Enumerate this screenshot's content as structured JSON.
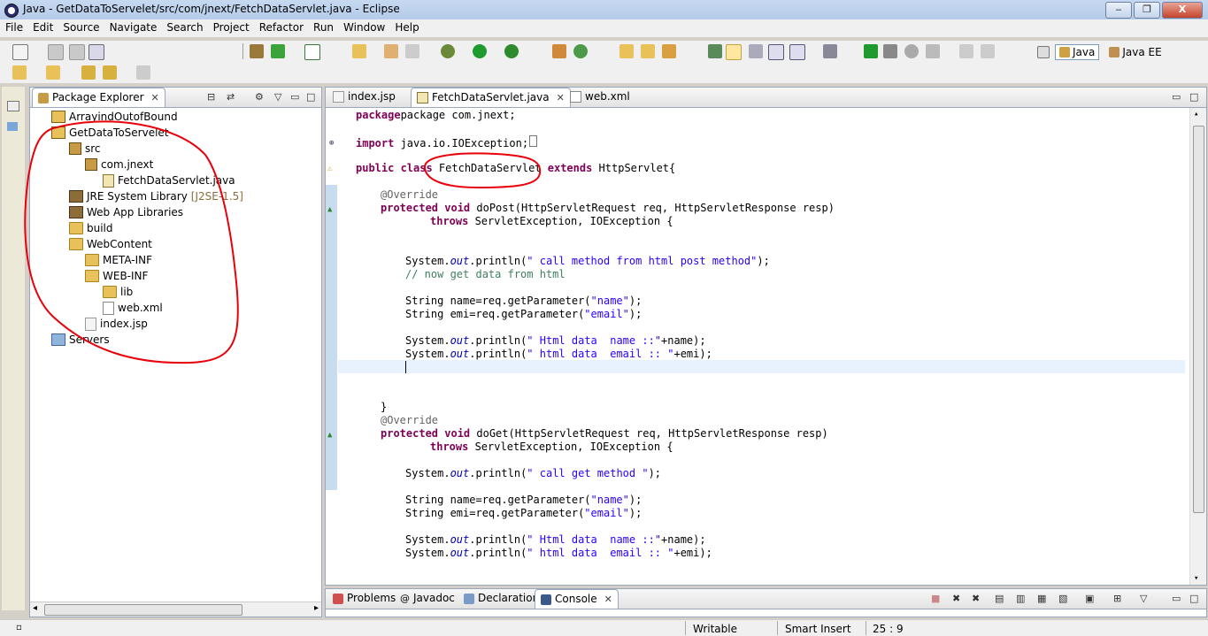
{
  "window": {
    "title": "Java - GetDataToServelet/src/com/jnext/FetchDataServlet.java - Eclipse",
    "minimize": "‒",
    "maximize": "❐",
    "close": "X"
  },
  "menu": [
    "File",
    "Edit",
    "Source",
    "Navigate",
    "Search",
    "Project",
    "Refactor",
    "Run",
    "Window",
    "Help"
  ],
  "perspectives": {
    "java": "Java",
    "javaee": "Java EE"
  },
  "package_explorer": {
    "title": "Package Explorer",
    "items": [
      {
        "label": "ArrayindOutofBound",
        "icon": "project-icon"
      },
      {
        "label": "GetDataToServelet",
        "icon": "project-icon"
      },
      {
        "label": "src",
        "icon": "source-folder-icon"
      },
      {
        "label": "com.jnext",
        "icon": "package-icon"
      },
      {
        "label": "FetchDataServlet.java",
        "icon": "java-file-icon"
      },
      {
        "label": "JRE System Library",
        "suffix": "[J2SE-1.5]",
        "icon": "library-icon"
      },
      {
        "label": "Web App Libraries",
        "icon": "library-icon"
      },
      {
        "label": "build",
        "icon": "folder-icon"
      },
      {
        "label": "WebContent",
        "icon": "folder-icon"
      },
      {
        "label": "META-INF",
        "icon": "folder-icon"
      },
      {
        "label": "WEB-INF",
        "icon": "folder-icon"
      },
      {
        "label": "lib",
        "icon": "folder-icon"
      },
      {
        "label": "web.xml",
        "icon": "xml-file-icon"
      },
      {
        "label": "index.jsp",
        "icon": "jsp-file-icon"
      },
      {
        "label": "Servers",
        "icon": "servers-folder-icon"
      }
    ]
  },
  "editor": {
    "tabs": [
      {
        "label": "index.jsp"
      },
      {
        "label": "FetchDataServlet.java"
      },
      {
        "label": "web.xml"
      }
    ],
    "lines": {
      "l1": "package com.jnext;",
      "l2_kw": "import",
      "l2": " java.io.IOException;",
      "l3_kw": "public class",
      "l3_name": " FetchDataServlet ",
      "l3_kw2": "extends",
      "l3_rest": " HttpServlet{",
      "l4": "@Override",
      "l5_kw": "protected void",
      "l5": " doPost(HttpServletRequest req, HttpServletResponse resp)",
      "l6_kw": "throws",
      "l6": " ServletException, IOException {",
      "l7_a": "System.",
      "l7_f": "out",
      "l7_b": ".println(",
      "l7_s": "\" call method from html post method\"",
      "l7_c": ");",
      "l8": "// now get data from html",
      "l9_a": "String name=req.getParameter(",
      "l9_s": "\"name\"",
      "l9_c": ");",
      "l10_a": "String emi=req.getParameter(",
      "l10_s": "\"email\"",
      "l10_c": ");",
      "l11_s": "\" Html data  name ::\"",
      "l11_c": "+name);",
      "l12_s": "\" html data  email :: \"",
      "l12_c": "+emi);",
      "l13": "}",
      "l14": "@Override",
      "l15": " doGet(HttpServletRequest req, HttpServletResponse resp)",
      "l16_s": "\" call get method \"",
      "l16_c": ");"
    }
  },
  "bottom_panel": {
    "tabs": [
      {
        "label": "Problems"
      },
      {
        "label": "Javadoc"
      },
      {
        "label": "Declaration"
      },
      {
        "label": "Console"
      }
    ]
  },
  "status": {
    "writable": "Writable",
    "insert_mode": "Smart Insert",
    "position": "25 : 9"
  },
  "colors": {
    "annotation": "#e8000b",
    "keyword": "#7f0055",
    "string": "#2a00ff",
    "comment": "#3f7f5f"
  }
}
